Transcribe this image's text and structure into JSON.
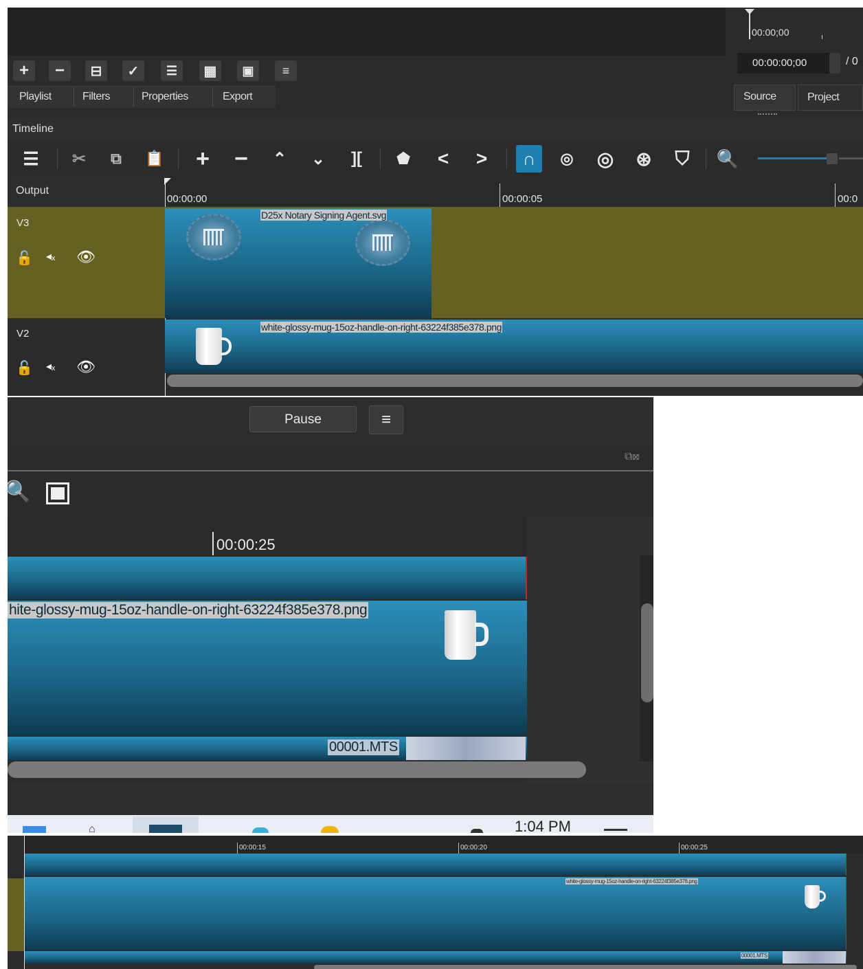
{
  "top": {
    "timecode_ruler": "00:00;00",
    "timecode_field": "00:00:00;00",
    "timecode_total_prefix": "/ 0",
    "playlist_buttons": [
      {
        "name": "add-icon",
        "glyph": "+"
      },
      {
        "name": "remove-icon",
        "glyph": "−"
      },
      {
        "name": "update-icon",
        "glyph": "⊟"
      },
      {
        "name": "check-icon",
        "glyph": "✓"
      },
      {
        "name": "details-view-icon",
        "glyph": "☰"
      },
      {
        "name": "tiles-view-icon",
        "glyph": "▦"
      },
      {
        "name": "icons-view-icon",
        "glyph": "▣"
      },
      {
        "name": "menu-icon",
        "glyph": "≡"
      }
    ],
    "tabs": [
      "Playlist",
      "Filters",
      "Properties",
      "Export"
    ],
    "source_tab": "Source",
    "project_tab": "Project",
    "timeline_label": "Timeline",
    "output_label": "Output",
    "ruler_ticks": [
      "00:00:00",
      "00:00:05",
      "00:0"
    ],
    "tracks": [
      {
        "name": "V3",
        "clip": "D25x Notary Signing Agent.svg"
      },
      {
        "name": "V2",
        "clip": "white-glossy-mug-15oz-handle-on-right-63224f385e378.png"
      }
    ]
  },
  "middle": {
    "pause_label": "Pause",
    "ruler_tick": "00:00:25",
    "clip_label": "hite-glossy-mug-15oz-handle-on-right-63224f385e378.png",
    "mts_label": "00001.MTS",
    "taskbar_time": "1:04 PM"
  },
  "bottom": {
    "ruler_ticks": [
      "00:00:15",
      "00:00:20",
      "00:00:25"
    ],
    "clip_label": "white-glossy-mug-15oz-handle-on-right-63224f385e378.png",
    "mts_label": "00001.MTS"
  },
  "colors": {
    "app_bg": "#2b2b2b",
    "track_olive": "#656123",
    "clip_blue": "#1f6f93",
    "label_bg": "#c8c8c8"
  }
}
